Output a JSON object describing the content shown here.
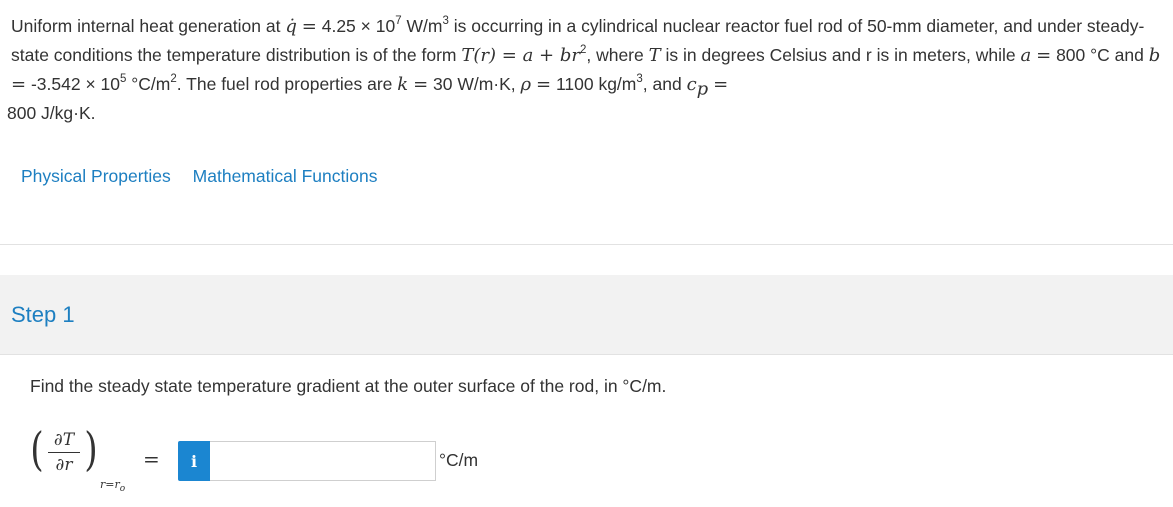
{
  "problem": {
    "p1": "Uniform internal heat generation at",
    "qdot": "q̇",
    "eq": "=",
    "q_value": "4.25 × 10",
    "q_exp": "7",
    "q_unit": " W/m",
    "q_unit_exp": "3",
    "p2": " is occurring in a cylindrical nuclear reactor fuel rod of 50-mm diameter, and under steady-state conditions the temperature distribution is of the form ",
    "form_lhs": "T",
    "form_mid": "(r) = a + br",
    "form_exp": "2",
    "p3": ", where ",
    "T_var": "T",
    "p4": " is in degrees Celsius and r is in meters, while ",
    "a_var": "a",
    "a_value": " 800 °C and ",
    "b_var": "b",
    "b_value": " -3.542 × 10",
    "b_exp": "5",
    "b_unit": " °C/m",
    "b_unit_exp": "2",
    "p5": ". The fuel rod properties are ",
    "k_var": "k",
    "k_value": " 30 W/m·K, ",
    "rho_var": "ρ",
    "rho_value": " 1100 kg/m",
    "rho_exp": "3",
    "p6": ", and ",
    "cp_var": "c",
    "cp_sub": "p",
    "cp_value": " 800 J/kg·K."
  },
  "links": {
    "physical": "Physical Properties",
    "math": "Mathematical Functions"
  },
  "step": {
    "title": "Step 1",
    "question": "Find the steady state temperature gradient at the outer surface of the rod, in °C/m."
  },
  "derivative": {
    "numerator": "∂T",
    "denominator": "∂r",
    "left_paren": "(",
    "right_paren": ")",
    "eval_at": "r=r",
    "eval_sub": "o",
    "equals": "="
  },
  "answer": {
    "info_label": "i",
    "value": "",
    "unit": "°C/m"
  }
}
